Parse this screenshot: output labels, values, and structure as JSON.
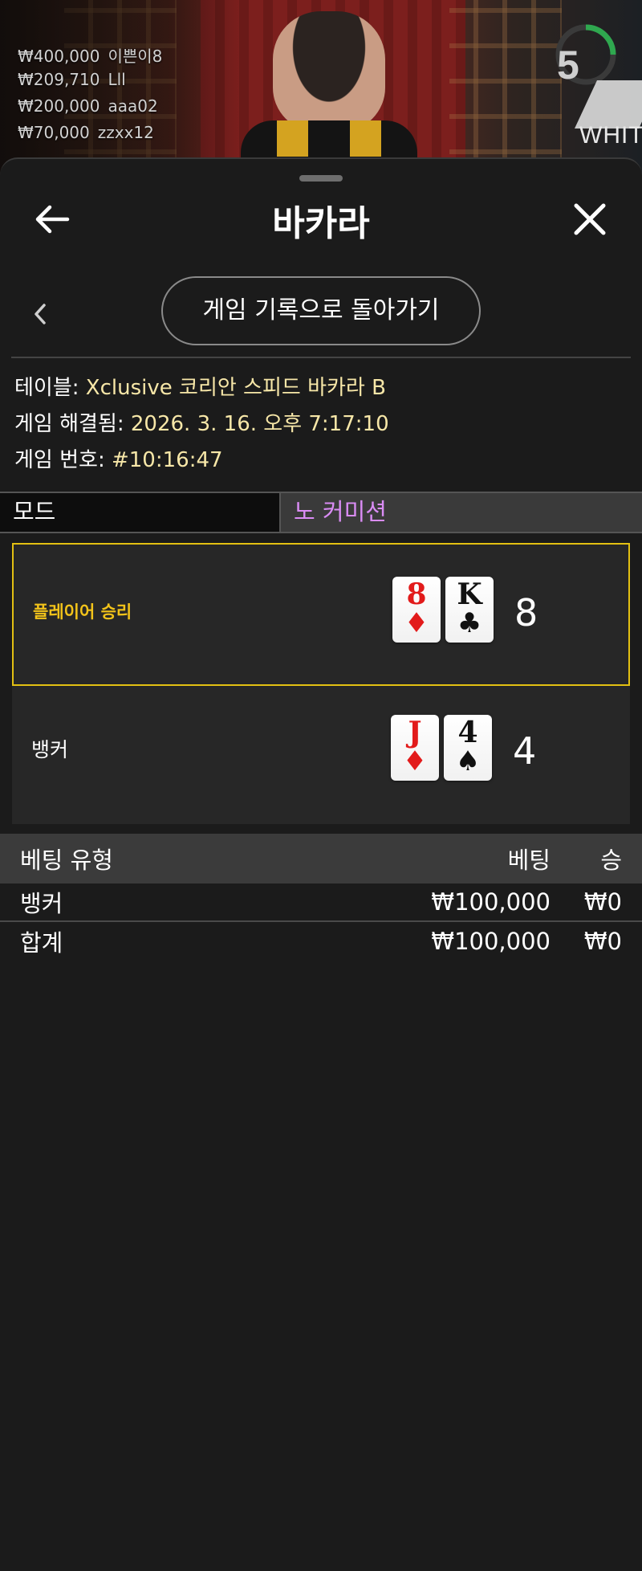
{
  "winners": [
    {
      "amount": "",
      "name": ""
    },
    {
      "amount": "₩400,000",
      "name": "이쁜이8"
    },
    {
      "amount": "₩209,710",
      "name": "Lll"
    },
    {
      "amount": "₩200,000",
      "name": "aaa02"
    },
    {
      "amount": "₩70,000",
      "name": "zzxx12"
    }
  ],
  "timer": {
    "value": "5",
    "brand": "WHITE"
  },
  "header": {
    "title": "바카라"
  },
  "back_button": {
    "label": "게임 기록으로 돌아가기"
  },
  "info": {
    "table_label": "테이블:",
    "table_value": "Xclusive 코리안 스피드 바카라 B",
    "resolved_label": "게임 해결됨:",
    "resolved_value": "2026. 3. 16. 오후 7:17:10",
    "number_label": "게임 번호:",
    "number_value": "#10:16:47"
  },
  "mode": {
    "label": "모드",
    "value": "노 커미션"
  },
  "hands": {
    "player": {
      "label": "플레이어 승리",
      "score": "8",
      "cards": [
        {
          "rank": "8",
          "suit": "♦"
        },
        {
          "rank": "K",
          "suit": "♣"
        }
      ]
    },
    "banker": {
      "label": "뱅커",
      "score": "4",
      "cards": [
        {
          "rank": "J",
          "suit": "♦"
        },
        {
          "rank": "4",
          "suit": "♠"
        }
      ]
    }
  },
  "bet_table": {
    "headers": {
      "type": "베팅 유형",
      "bet": "베팅",
      "win": "승"
    },
    "rows": [
      {
        "type": "뱅커",
        "bet": "₩100,000",
        "win": "₩0"
      }
    ],
    "total": {
      "type": "합계",
      "bet": "₩100,000",
      "win": "₩0"
    }
  },
  "colors": {
    "accent_gold": "#e3c012",
    "mode_value": "#da8cf5",
    "info_value": "#f7e7a8"
  }
}
